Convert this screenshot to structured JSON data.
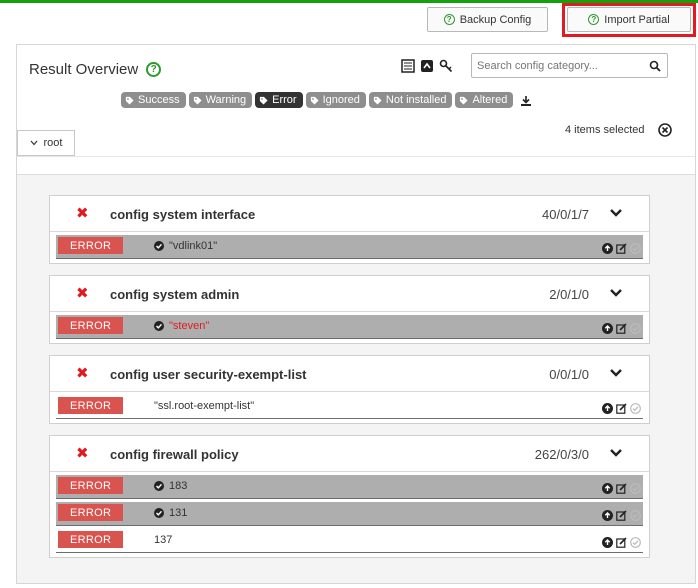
{
  "toolbar": {
    "backup_label": "Backup Config",
    "import_label": "Import Partial"
  },
  "overview": {
    "title": "Result Overview",
    "search_placeholder": "Search config category..."
  },
  "filters": [
    {
      "label": "Success",
      "active": false
    },
    {
      "label": "Warning",
      "active": false
    },
    {
      "label": "Error",
      "active": true
    },
    {
      "label": "Ignored",
      "active": false
    },
    {
      "label": "Not installed",
      "active": false
    },
    {
      "label": "Altered",
      "active": false
    }
  ],
  "selection": {
    "text": "4 items selected"
  },
  "tree": {
    "root_label": "root"
  },
  "colors": {
    "error": "#d9534f",
    "highlight": "#e11b22",
    "accent": "#2c9a2c"
  },
  "cards": [
    {
      "name": "config system interface",
      "counts": "40/0/1/7",
      "rows": [
        {
          "status": "ERROR",
          "value": "\"vdlink01\"",
          "checked": true,
          "gray": true,
          "red": false
        }
      ]
    },
    {
      "name": "config system admin",
      "counts": "2/0/1/0",
      "rows": [
        {
          "status": "ERROR",
          "value": "\"steven\"",
          "checked": true,
          "gray": true,
          "red": true
        }
      ]
    },
    {
      "name": "config user security-exempt-list",
      "counts": "0/0/1/0",
      "rows": [
        {
          "status": "ERROR",
          "value": "\"ssl.root-exempt-list\"",
          "checked": false,
          "gray": false,
          "red": false
        }
      ]
    },
    {
      "name": "config firewall policy",
      "counts": "262/0/3/0",
      "rows": [
        {
          "status": "ERROR",
          "value": "183",
          "checked": true,
          "gray": true,
          "red": false
        },
        {
          "status": "ERROR",
          "value": "131",
          "checked": true,
          "gray": true,
          "red": false
        },
        {
          "status": "ERROR",
          "value": "137",
          "checked": false,
          "gray": false,
          "red": false
        }
      ]
    }
  ]
}
